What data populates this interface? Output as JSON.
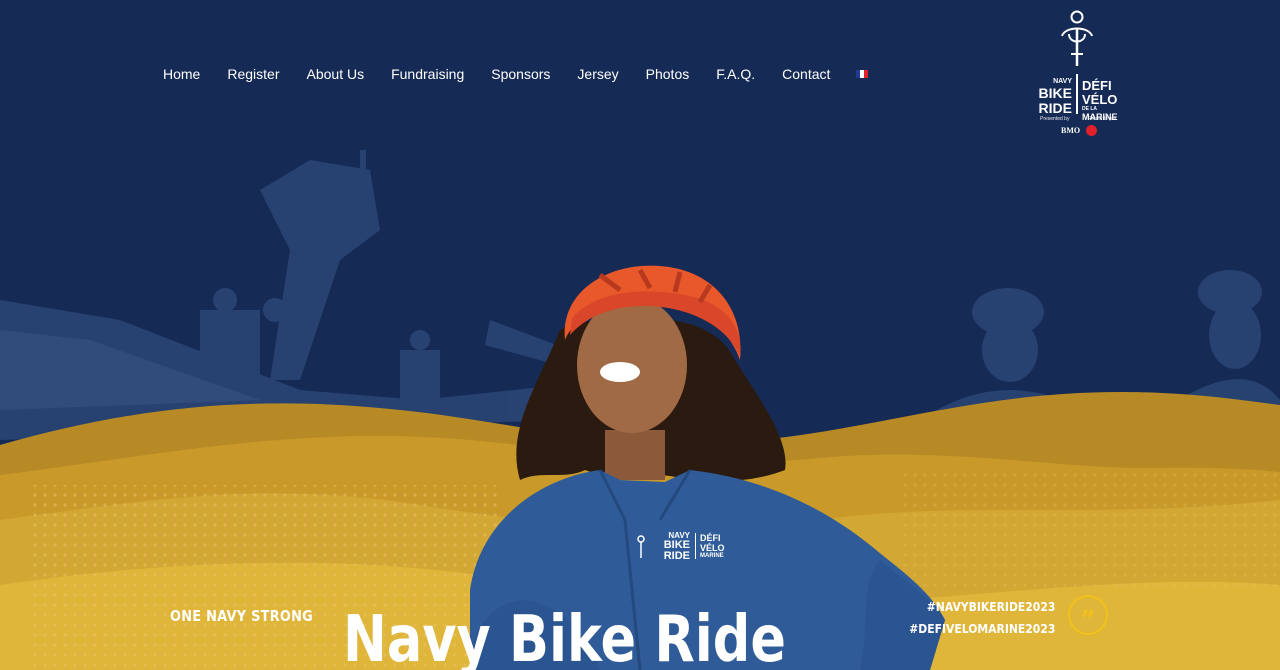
{
  "nav": {
    "items": [
      "Home",
      "Register",
      "About Us",
      "Fundraising",
      "Sponsors",
      "Jersey",
      "Photos",
      "F.A.Q.",
      "Contact"
    ],
    "language_flag": "france-flag-icon"
  },
  "logo": {
    "en_line1": "NAVY",
    "en_line2": "BIKE",
    "en_line3": "RIDE",
    "fr_line1": "DÉFI",
    "fr_line2": "VÉLO",
    "fr_line3": "DE LA",
    "fr_line4": "MARINE",
    "presented_en": "Presented by",
    "presented_fr": "Présenté par",
    "sponsor": "BMO"
  },
  "jersey": {
    "en_line1": "NAVY",
    "en_line2": "BIKE",
    "en_line3": "RIDE",
    "fr_line1": "DÉFI",
    "fr_line2": "VÉLO",
    "fr_line3": "MARINE"
  },
  "hero": {
    "tagline": "ONE NAVY STRONG",
    "title": "Navy Bike Ride",
    "hashtag_1": "#NAVYBIKERIDE2023",
    "hashtag_2": "#DEFIVELOMARINE2023",
    "quote_glyph": "”"
  },
  "colors": {
    "navy": "#152a55",
    "gold": "#c99a2a",
    "gold_light": "#dfb53a",
    "accent_yellow": "#f2c21b",
    "jacket_blue": "#2f5c98",
    "helmet_orange": "#e8582a"
  }
}
